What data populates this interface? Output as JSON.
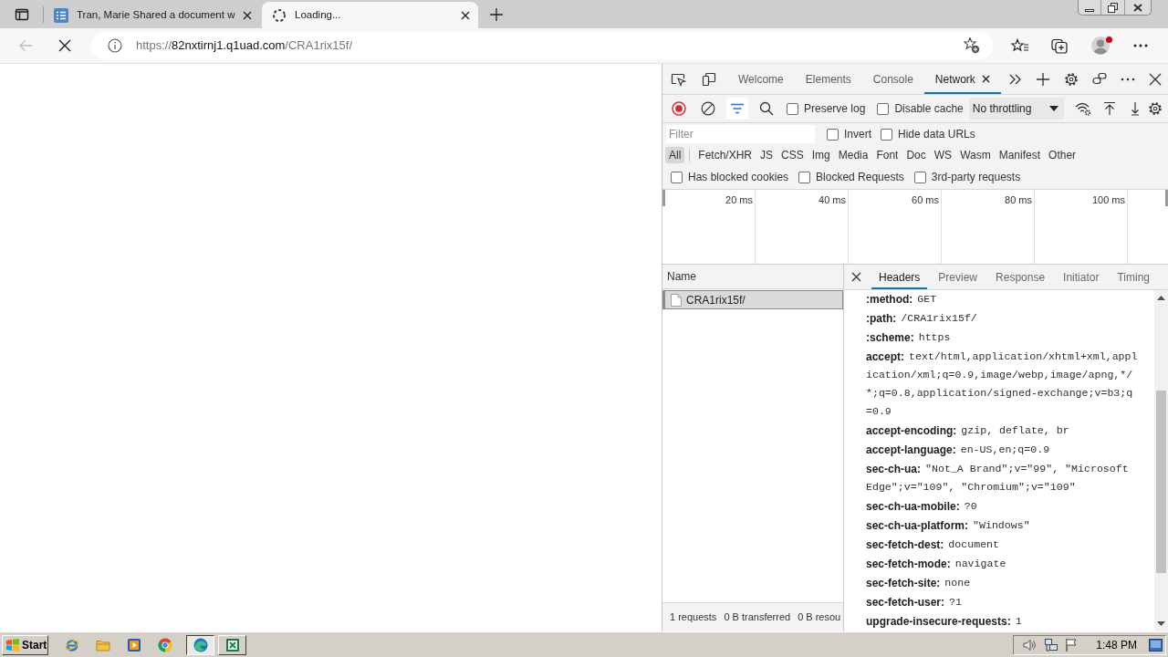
{
  "browser": {
    "tabs": [
      {
        "title": "Tran, Marie Shared a document w",
        "loading": false,
        "selected": false
      },
      {
        "title": "Loading...",
        "loading": true,
        "selected": true
      }
    ],
    "back_button": {
      "disabled": true
    },
    "address": {
      "scheme": "https://",
      "host": "82nxtirnj1.q1uad.com",
      "path": "/CRA1rix15f/"
    }
  },
  "devtools": {
    "tabs": [
      {
        "label": "Welcome",
        "selected": false
      },
      {
        "label": "Elements",
        "selected": false
      },
      {
        "label": "Console",
        "selected": false
      },
      {
        "label": "Network",
        "selected": true
      }
    ],
    "recording": true,
    "filter_toggle": {
      "on": true
    },
    "toolbar_checkboxes": [
      {
        "label": "Preserve log",
        "checked": false
      },
      {
        "label": "Disable cache",
        "checked": false
      }
    ],
    "throttling": "No throttling",
    "filter": {
      "placeholder": "Filter"
    },
    "filter_checkboxes": [
      {
        "label": "Invert",
        "checked": false
      },
      {
        "label": "Hide data URLs",
        "checked": false
      }
    ],
    "type_filters": [
      {
        "label": "All",
        "selected": true
      },
      {
        "label": "Fetch/XHR",
        "selected": false
      },
      {
        "label": "JS",
        "selected": false
      },
      {
        "label": "CSS",
        "selected": false
      },
      {
        "label": "Img",
        "selected": false
      },
      {
        "label": "Media",
        "selected": false
      },
      {
        "label": "Font",
        "selected": false
      },
      {
        "label": "Doc",
        "selected": false
      },
      {
        "label": "WS",
        "selected": false
      },
      {
        "label": "Wasm",
        "selected": false
      },
      {
        "label": "Manifest",
        "selected": false
      },
      {
        "label": "Other",
        "selected": false
      }
    ],
    "extra_checkboxes": [
      {
        "label": "Has blocked cookies",
        "checked": false
      },
      {
        "label": "Blocked Requests",
        "checked": false
      },
      {
        "label": "3rd-party requests",
        "checked": false
      }
    ],
    "timeline": {
      "ticks": [
        "20 ms",
        "40 ms",
        "60 ms",
        "80 ms",
        "100 ms"
      ]
    },
    "requests": {
      "column": "Name",
      "rows": [
        {
          "name": "CRA1rix15f/",
          "selected": true
        }
      ],
      "summary": [
        "1 requests",
        "0 B transferred",
        "0 B resou"
      ]
    },
    "details": {
      "tabs": [
        {
          "label": "Headers",
          "selected": true
        },
        {
          "label": "Preview",
          "selected": false
        },
        {
          "label": "Response",
          "selected": false
        },
        {
          "label": "Initiator",
          "selected": false
        },
        {
          "label": "Timing",
          "selected": false
        }
      ],
      "headers": [
        {
          "name": ":method:",
          "value": "GET"
        },
        {
          "name": ":path:",
          "value": "/CRA1rix15f/"
        },
        {
          "name": ":scheme:",
          "value": "https"
        },
        {
          "name": "accept:",
          "value": "text/html,application/xhtml+xml,application/xml;q=0.9,image/webp,image/apng,*/*;q=0.8,application/signed-exchange;v=b3;q=0.9"
        },
        {
          "name": "accept-encoding:",
          "value": "gzip, deflate, br"
        },
        {
          "name": "accept-language:",
          "value": "en-US,en;q=0.9"
        },
        {
          "name": "sec-ch-ua:",
          "value": "\"Not_A Brand\";v=\"99\", \"Microsoft Edge\";v=\"109\", \"Chromium\";v=\"109\""
        },
        {
          "name": "sec-ch-ua-mobile:",
          "value": "?0"
        },
        {
          "name": "sec-ch-ua-platform:",
          "value": "\"Windows\""
        },
        {
          "name": "sec-fetch-dest:",
          "value": "document"
        },
        {
          "name": "sec-fetch-mode:",
          "value": "navigate"
        },
        {
          "name": "sec-fetch-site:",
          "value": "none"
        },
        {
          "name": "sec-fetch-user:",
          "value": "?1"
        },
        {
          "name": "upgrade-insecure-requests:",
          "value": "1"
        }
      ]
    }
  },
  "taskbar": {
    "start": "Start",
    "quick_launch": [
      {
        "kind": "globe"
      },
      {
        "kind": "folder"
      },
      {
        "kind": "player"
      },
      {
        "kind": "ring"
      }
    ],
    "windows": [
      {
        "kind": "wave",
        "selected": true
      },
      {
        "kind": "sheet",
        "selected": false
      }
    ],
    "clock": "1:48 PM"
  }
}
